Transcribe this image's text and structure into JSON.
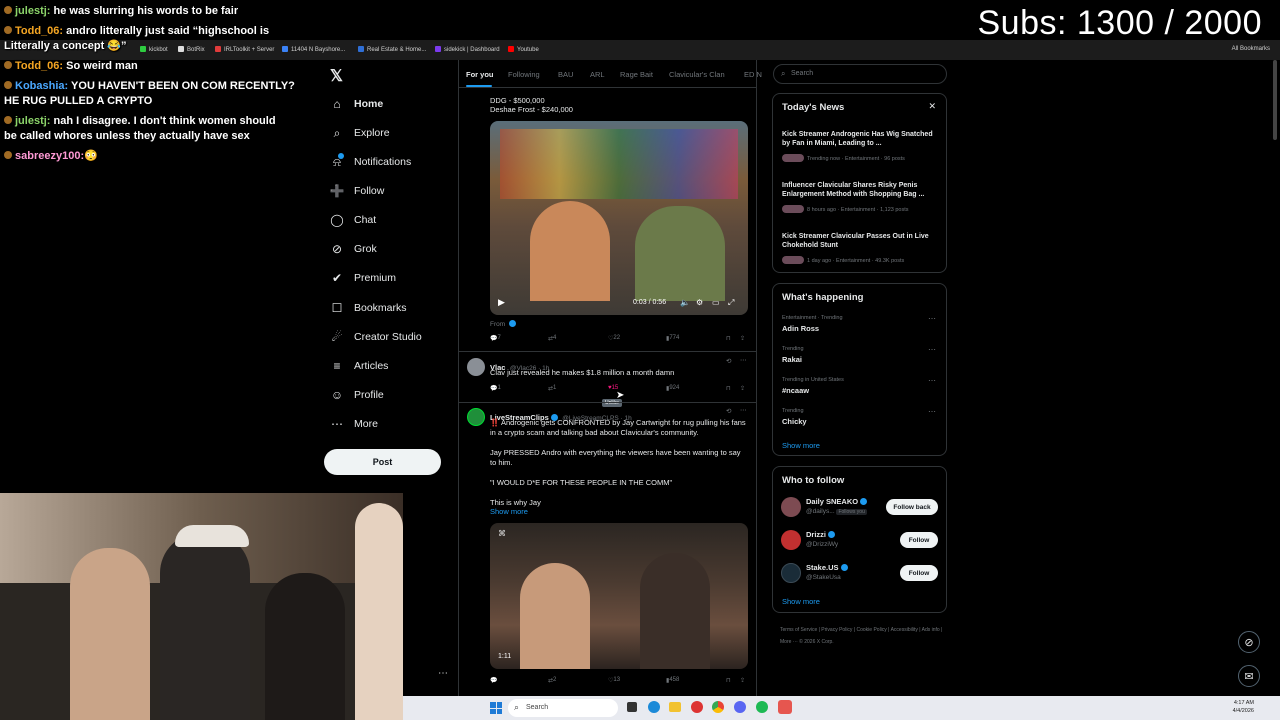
{
  "overlay": {
    "subs_counter": "Subs: 1300 / 2000",
    "chat": [
      {
        "user": "julestj:",
        "user_color": "#8cd46a",
        "message": "he was slurring his words to be fair"
      },
      {
        "user": "Todd_06:",
        "user_color": "#f5a623",
        "message": "andro litterally just said “highschool is"
      },
      {
        "user": "",
        "user_color": "#ffffff",
        "message": "Litterally a concept 😂”"
      },
      {
        "user": "Todd_06:",
        "user_color": "#f5a623",
        "message": "So weird man"
      },
      {
        "user": "Kobashia:",
        "user_color": "#4aa8ff",
        "message": "YOU HAVEN'T BEEN ON COM RECENTLY?"
      },
      {
        "user": "",
        "user_color": "#ffffff",
        "message": "HE RUG PULLED A CRYPTO"
      },
      {
        "user": "julestj:",
        "user_color": "#8cd46a",
        "message": "nah I disagree. I don't think women should"
      },
      {
        "user": "",
        "user_color": "#ffffff",
        "message": "be called whores unless they actually have sex"
      },
      {
        "user": "sabreezy100:",
        "user_color": "#ff9ad5",
        "message": "😳"
      }
    ]
  },
  "bookmarks": [
    {
      "label": "kickbot",
      "color": "#2ecc40"
    },
    {
      "label": "BotRix",
      "color": "#dddddd"
    },
    {
      "label": "IRLToolkit + Server",
      "color": "#e03b3b"
    },
    {
      "label": "11404 N Bayshore...",
      "color": "#3b82f6"
    },
    {
      "label": "Real Estate & Home...",
      "color": "#2f6fd6"
    },
    {
      "label": "sidekick | Dashboard",
      "color": "#7c3aed"
    },
    {
      "label": "Youtube",
      "color": "#ff0000"
    }
  ],
  "bookmarks_all": "All Bookmarks",
  "nav": {
    "logo": "𝕏",
    "items": [
      {
        "label": "Home",
        "icon": "⌂"
      },
      {
        "label": "Explore",
        "icon": "⌕"
      },
      {
        "label": "Notifications",
        "icon": "⍾"
      },
      {
        "label": "Follow",
        "icon": "➕"
      },
      {
        "label": "Chat",
        "icon": "◯"
      },
      {
        "label": "Grok",
        "icon": "⊘"
      },
      {
        "label": "Premium",
        "icon": "✔"
      },
      {
        "label": "Bookmarks",
        "icon": "☐"
      },
      {
        "label": "Creator Studio",
        "icon": "☄"
      },
      {
        "label": "Articles",
        "icon": "≡"
      },
      {
        "label": "Profile",
        "icon": "☺"
      },
      {
        "label": "More",
        "icon": "⋯"
      }
    ],
    "post": "Post"
  },
  "feed": {
    "tabs": [
      "For you",
      "Following",
      "BAU",
      "ARL",
      "Rage Bait",
      "Clavicular's Clan",
      "ED N"
    ],
    "tweet1": {
      "line1": "DDG - $500,000",
      "line2": "Deshae Frost - $240,000",
      "video_time": "0:03 / 0:56",
      "from": "From",
      "replies": "7",
      "reposts": "4",
      "likes": "22",
      "views": "774"
    },
    "tweet2": {
      "name": "Vlac",
      "handle": "@Vlac26 · 1h",
      "text": "Clav just revealed he makes $1.8 million a month damn",
      "replies": "1",
      "reposts": "1",
      "likes": "15",
      "views": "924",
      "tooltip": "Unlike",
      "like_color": "#f91880"
    },
    "tweet3": {
      "name": "LiveStreamClips",
      "handle": "@LiveStreamCLPS · 1h",
      "p1": "‼️ Androgenic gets CONFRONTED by Jay Cartwright for rug pulling his fans in a crypto scam and talking bad about Clavicular's community.",
      "p2": "Jay PRESSED Andro with everything the viewers have been wanting to say to him.",
      "p3": "\"I WOULD D*E FOR THESE PEOPLE IN THE COMM\"",
      "p4": "This is why Jay",
      "show_more": "Show more",
      "video_time": "1:11",
      "replies": "",
      "reposts": "2",
      "likes": "13",
      "views": "458"
    }
  },
  "right": {
    "search_placeholder": "Search",
    "news": {
      "title": "Today's News",
      "items": [
        {
          "title": "Kick Streamer Androgenic Has Wig Snatched by Fan in Miami, Leading to ...",
          "meta": "Trending now · Entertainment · 96 posts"
        },
        {
          "title": "Influencer Clavicular Shares Risky Penis Enlargement Method with Shopping Bag ...",
          "meta": "8 hours ago · Entertainment · 1,123 posts"
        },
        {
          "title": "Kick Streamer Clavicular Passes Out in Live Chokehold Stunt",
          "meta": "1 day ago · Entertainment · 49.3K posts"
        }
      ]
    },
    "happening": {
      "title": "What's happening",
      "items": [
        {
          "category": "Entertainment · Trending",
          "name": "Adin Ross"
        },
        {
          "category": "Trending",
          "name": "Rakai"
        },
        {
          "category": "Trending in United States",
          "name": "#ncaaw"
        },
        {
          "category": "Trending",
          "name": "Chicky"
        }
      ],
      "show_more": "Show more"
    },
    "who_to_follow": {
      "title": "Who to follow",
      "items": [
        {
          "name": "Daily SNEAKO",
          "handle": "@dailys...",
          "follows_you": "Follows you",
          "button": "Follow back"
        },
        {
          "name": "Drizzi",
          "handle": "@DrizziWy",
          "button": "Follow"
        },
        {
          "name": "Stake.US",
          "handle": "@StakeUsa",
          "button": "Follow"
        }
      ],
      "show_more": "Show more"
    },
    "footer": "Terms of Service   |   Privacy Policy   |   Cookie Policy   |   Accessibility   |   Ads info   |   More ···   © 2026 X Corp."
  },
  "taskbar": {
    "search": "Search",
    "time": "4:17 AM",
    "date": "4/4/2026"
  }
}
